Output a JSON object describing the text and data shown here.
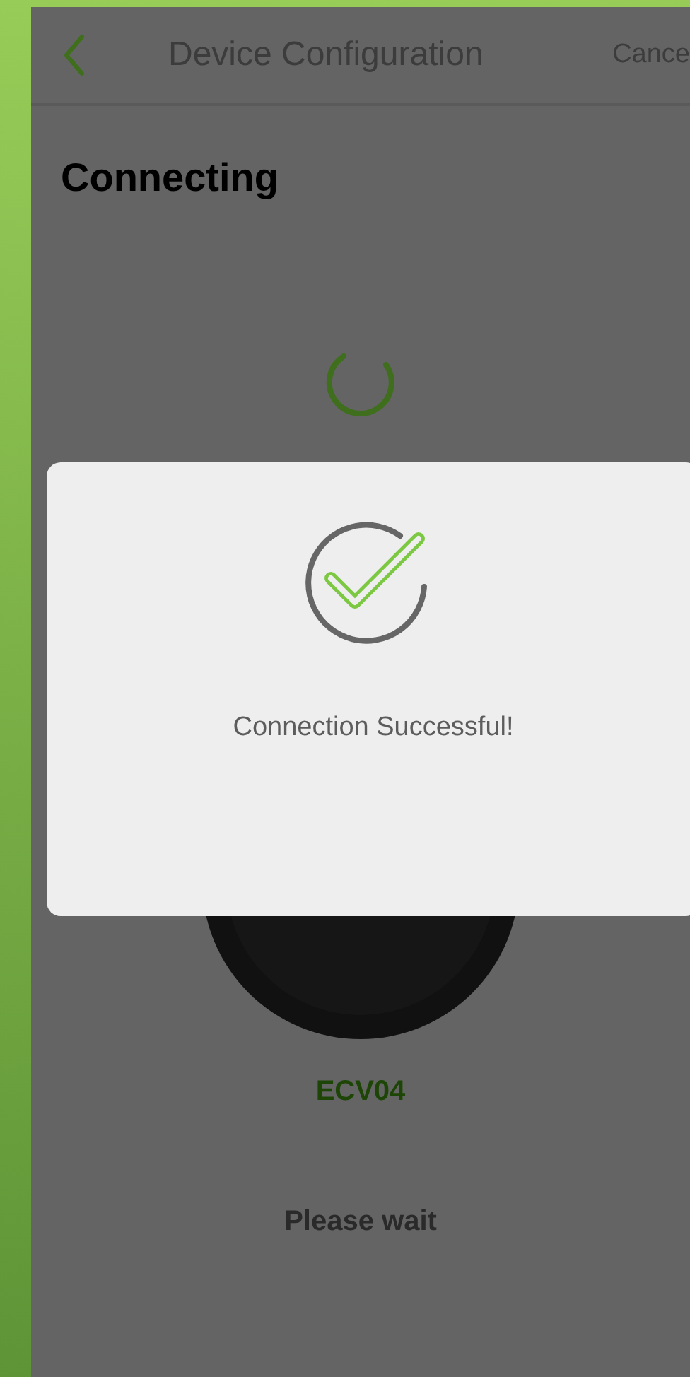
{
  "header": {
    "title": "Device Configuration",
    "action": "Cance"
  },
  "heading": "Connecting",
  "device": {
    "name": "ECV04"
  },
  "status": "Please wait",
  "dialog": {
    "message": "Connection Successful!"
  }
}
